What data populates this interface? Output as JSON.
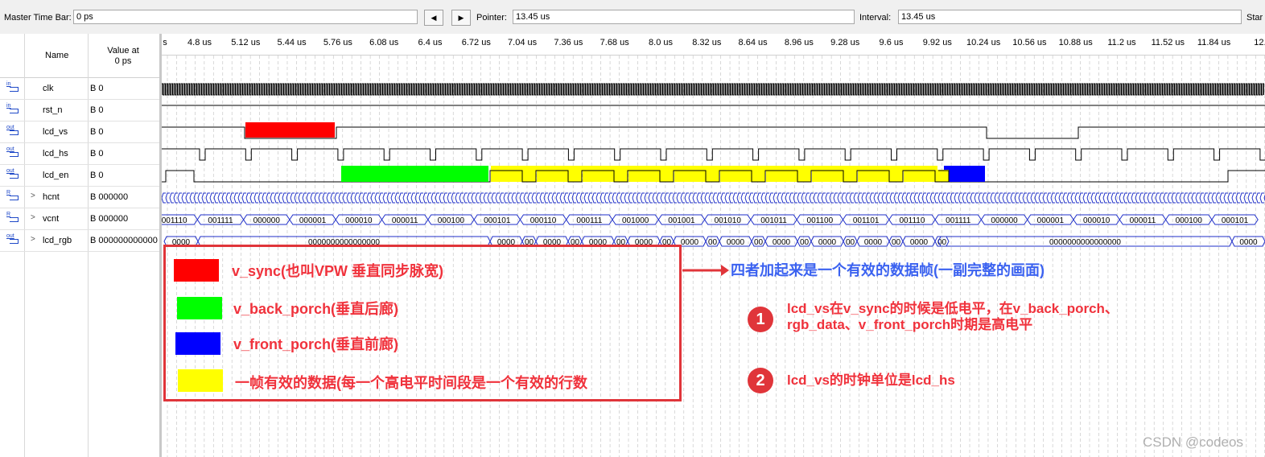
{
  "toolbar": {
    "master_label": "Master Time Bar:",
    "master_value": "0 ps",
    "prev_icon": "◀",
    "next_icon": "▶",
    "pointer_label": "Pointer:",
    "pointer_value": "13.45 us",
    "interval_label": "Interval:",
    "interval_value": "13.45 us",
    "start_label": "Star"
  },
  "header": {
    "name": "Name",
    "value_line1": "Value at",
    "value_line2": "0 ps"
  },
  "signals": [
    {
      "icon": "in",
      "name": "clk",
      "value": "B 0",
      "expand": ""
    },
    {
      "icon": "in",
      "name": "rst_n",
      "value": "B 0",
      "expand": ""
    },
    {
      "icon": "out",
      "name": "lcd_vs",
      "value": "B 0",
      "expand": ""
    },
    {
      "icon": "out",
      "name": "lcd_hs",
      "value": "B 0",
      "expand": ""
    },
    {
      "icon": "out",
      "name": "lcd_en",
      "value": "B 0",
      "expand": ""
    },
    {
      "icon": "R",
      "name": "hcnt",
      "value": "B 000000",
      "expand": ">"
    },
    {
      "icon": "R",
      "name": "vcnt",
      "value": "B 000000",
      "expand": ">"
    },
    {
      "icon": "out",
      "name": "lcd_rgb",
      "value": "B 0000000000000000",
      "expand": ">"
    }
  ],
  "ruler": [
    "s",
    "4.8 us",
    "5.12 us",
    "5.44 us",
    "5.76 us",
    "6.08 us",
    "6.4 us",
    "6.72 us",
    "7.04 us",
    "7.36 us",
    "7.68 us",
    "8.0 us",
    "8.32 us",
    "8.64 us",
    "8.96 us",
    "9.28 us",
    "9.6 us",
    "9.92 us",
    "10.24 us",
    "10.56 us",
    "10.88 us",
    "11.2 us",
    "11.52 us",
    "11.84 us",
    "12."
  ],
  "vcnt_values": [
    "001110",
    "001111",
    "000000",
    "000001",
    "000010",
    "000011",
    "000100",
    "000101",
    "000110",
    "000111",
    "001000",
    "001001",
    "001010",
    "001011",
    "001100",
    "001101",
    "001110",
    "001111",
    "000000",
    "000001",
    "000010",
    "000011",
    "000100",
    "000101"
  ],
  "lcd_rgb": {
    "segment_a": "0000",
    "long_value": "0000000000000000",
    "short_value": "0000",
    "tiny_value": "00"
  },
  "legend": [
    {
      "color": "#ff0000",
      "text": "v_sync(也叫VPW 垂直同步脉宽)"
    },
    {
      "color": "#00ff00",
      "text": "v_back_porch(垂直后廊)"
    },
    {
      "color": "#0000ff",
      "text": "v_front_porch(垂直前廊)"
    },
    {
      "color": "#ffff00",
      "text": "一帧有效的数据(每一个高电平时间段是一个有效的行数"
    }
  ],
  "notes": {
    "summary": "四者加起来是一个有效的数据帧(一副完整的画面)",
    "n1_num": "1",
    "n1_line1": "lcd_vs在v_sync的时候是低电平，在v_back_porch、",
    "n1_line2": "rgb_data、v_front_porch时期是高电平",
    "n2_num": "2",
    "n2_text": "lcd_vs的时钟单位是lcd_hs"
  },
  "watermark": "CSDN @codeos"
}
